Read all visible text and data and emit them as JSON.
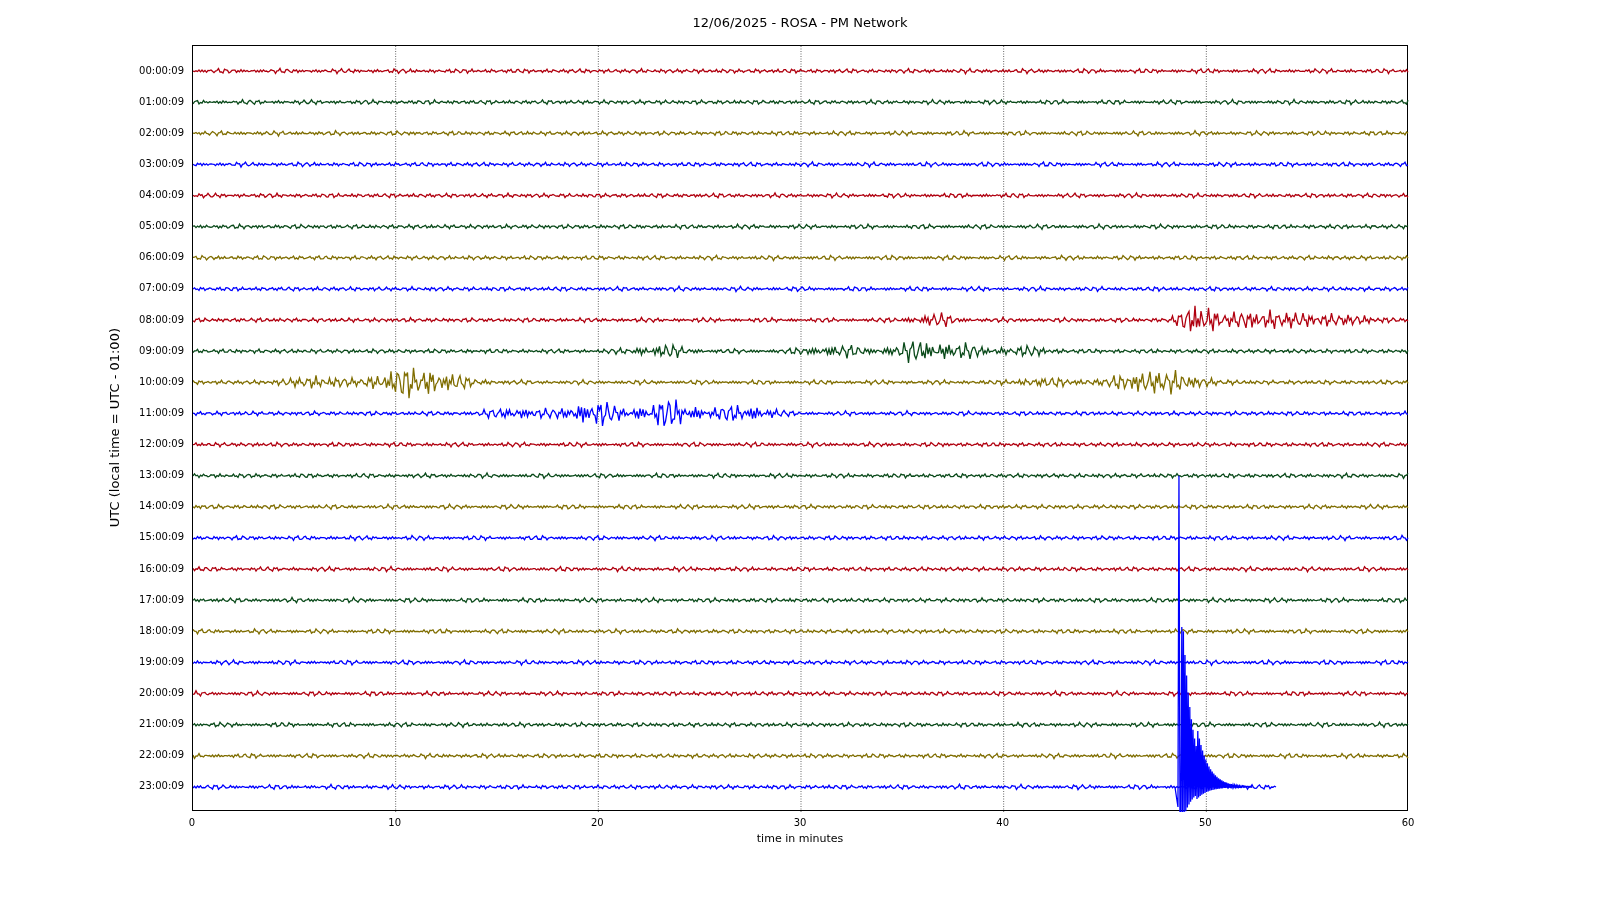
{
  "title": "12/06/2025 - ROSA - PM Network",
  "ylabel": "UTC (local time = UTC - 01:00)",
  "xlabel": "time in minutes",
  "xticks": [
    "0",
    "10",
    "20",
    "30",
    "40",
    "50",
    "60"
  ],
  "rows": [
    {
      "label": "00:00:09",
      "color": "#b0000f"
    },
    {
      "label": "01:00:09",
      "color": "#0a4a1a"
    },
    {
      "label": "02:00:09",
      "color": "#7f6d00"
    },
    {
      "label": "03:00:09",
      "color": "#0000ff"
    },
    {
      "label": "04:00:09",
      "color": "#b0000f"
    },
    {
      "label": "05:00:09",
      "color": "#0a4a1a"
    },
    {
      "label": "06:00:09",
      "color": "#7f6d00"
    },
    {
      "label": "07:00:09",
      "color": "#0000ff"
    },
    {
      "label": "08:00:09",
      "color": "#b0000f"
    },
    {
      "label": "09:00:09",
      "color": "#0a4a1a"
    },
    {
      "label": "10:00:09",
      "color": "#7f6d00"
    },
    {
      "label": "11:00:09",
      "color": "#0000ff"
    },
    {
      "label": "12:00:09",
      "color": "#b0000f"
    },
    {
      "label": "13:00:09",
      "color": "#0a4a1a"
    },
    {
      "label": "14:00:09",
      "color": "#7f6d00"
    },
    {
      "label": "15:00:09",
      "color": "#0000ff"
    },
    {
      "label": "16:00:09",
      "color": "#b0000f"
    },
    {
      "label": "17:00:09",
      "color": "#0a4a1a"
    },
    {
      "label": "18:00:09",
      "color": "#7f6d00"
    },
    {
      "label": "19:00:09",
      "color": "#0000ff"
    },
    {
      "label": "20:00:09",
      "color": "#b0000f"
    },
    {
      "label": "21:00:09",
      "color": "#0a4a1a"
    },
    {
      "label": "22:00:09",
      "color": "#7f6d00"
    },
    {
      "label": "23:00:09",
      "color": "#0000ff"
    }
  ]
}
